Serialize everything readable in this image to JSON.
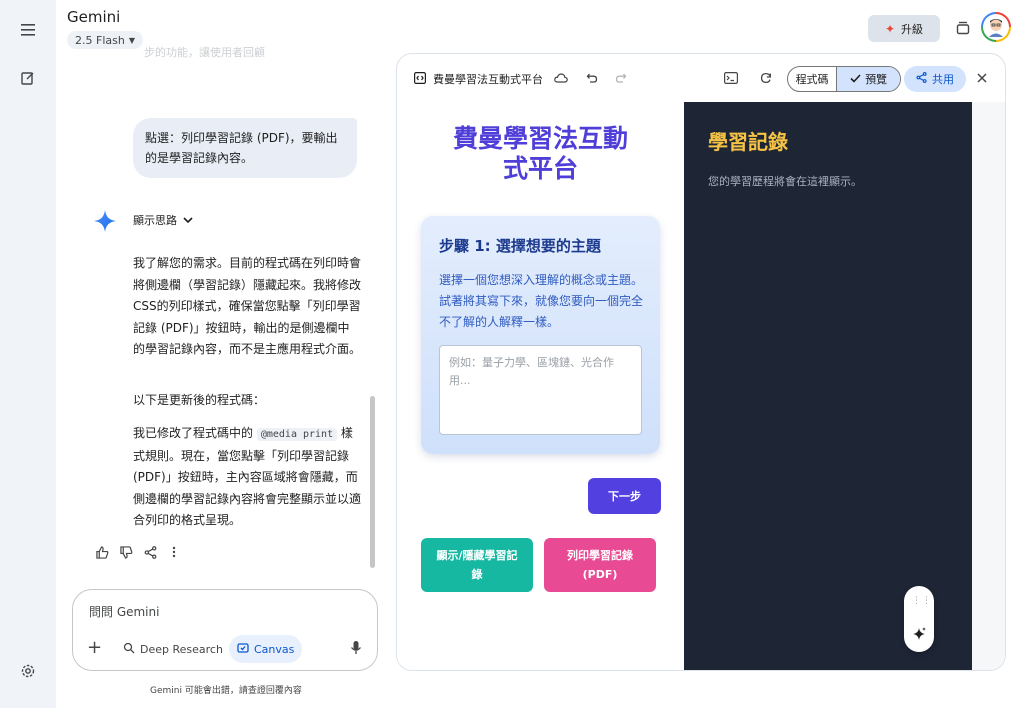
{
  "header": {
    "app_title": "Gemini",
    "model_label": "2.5 Flash",
    "upgrade_label": "升級"
  },
  "chat": {
    "faded_line": "步的功能，讓使用者回顧",
    "user_message": "點選：列印學習記錄 (PDF)，要輸出的是學習記錄內容。",
    "thinking_label": "顯示思路",
    "response_p1": "我了解您的需求。目前的程式碼在列印時會將側邊欄（學習記錄）隱藏起來。我將修改CSS的列印樣式，確保當您點擊「列印學習記錄 (PDF)」按鈕時，輸出的是側邊欄中的學習記錄內容，而不是主應用程式介面。",
    "response_p2": "以下是更新後的程式碼：",
    "response_p3_a": "我已修改了程式碼中的",
    "response_p3_code": "@media print",
    "response_p3_b": "樣式規則。現在，當您點擊「列印學習記錄 (PDF)」按鈕時，主內容區域將會隱藏，而側邊欄的學習記錄內容將會完整顯示並以適合列印的格式呈現。"
  },
  "input": {
    "placeholder": "問問 Gemini",
    "tool_deep_research": "Deep Research",
    "tool_canvas": "Canvas"
  },
  "disclaimer": "Gemini 可能會出錯，請查證回覆內容",
  "canvas": {
    "title": "費曼學習法互動式平台",
    "code_label": "程式碼",
    "preview_label": "預覽",
    "share_label": "共用",
    "app": {
      "main_title": "費曼學習法互動式平台",
      "step_title": "步驟 1: 選擇想要的主題",
      "step_desc": "選擇一個您想深入理解的概念或主題。試著將其寫下來，就像您要向一個完全不了解的人解釋一樣。",
      "textarea_placeholder": "例如：量子力學、區塊鏈、光合作用...",
      "next_label": "下一步",
      "toggle_sidebar_label": "顯示/隱藏學習記錄",
      "print_label": "列印學習記錄 (PDF)",
      "sidebar_title": "學習記錄",
      "sidebar_empty": "您的學習歷程將會在這裡顯示。"
    }
  },
  "colors": {
    "accent_purple": "#5240e0",
    "teal": "#17b8a2",
    "pink": "#e84a94",
    "sidebar_bg": "#1e2535",
    "sidebar_title": "#f6c344"
  },
  "icons": [
    "menu-icon",
    "new-chat-icon",
    "settings-icon",
    "chevron-down-icon",
    "sparkle-icon",
    "thumbs-up-icon",
    "thumbs-down-icon",
    "share-icon",
    "more-vert-icon",
    "plus-icon",
    "deep-research-icon",
    "canvas-icon",
    "mic-icon",
    "code-icon",
    "cloud-icon",
    "undo-icon",
    "redo-icon",
    "terminal-icon",
    "refresh-icon",
    "check-icon",
    "close-icon",
    "drag-handle-icon",
    "magic-wand-icon"
  ]
}
